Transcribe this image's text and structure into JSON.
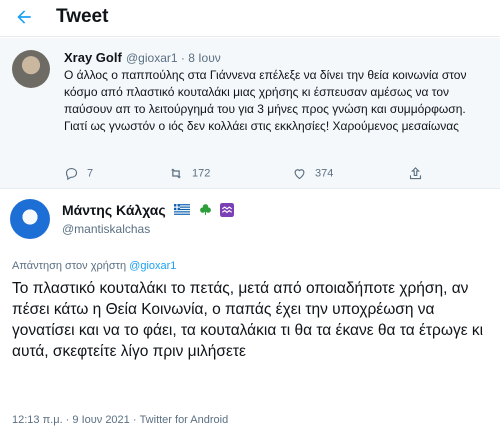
{
  "header": {
    "title": "Tweet",
    "back_icon": "back-arrow-icon",
    "accent": "#1da1f2"
  },
  "parent_tweet": {
    "display_name": "Xray Golf",
    "handle": "@gioxar1",
    "separator": " · ",
    "date": "8 Ιουν",
    "text": "Ο άλλος ο παππούλης στα Γιάννενα επέλεξε να δίνει την θεία κοινωνία στον κόσμο από πλαστικό κουταλάκι μιας χρήσης κι έσπευσαν αμέσως να τον παύσουν απ το λειτούργημά του για 3 μήνες προς γνώση και συμμόρφωση. Γιατί ως γνωστόν ο ιός δεν κολλάει στις εκκλησίες! Χαρούμενος μεσαίωνας",
    "actions": {
      "replies": "7",
      "retweets": "172",
      "likes": "374"
    }
  },
  "main_tweet": {
    "display_name": "Μάντης Κάλχας",
    "handle": "@mantiskalchas",
    "badges": [
      "greek-flag-icon",
      "shamrock-icon",
      "aquarius-sign-icon"
    ],
    "reply_prefix": "Απάντηση στον χρήστη ",
    "reply_to": "@gioxar1",
    "text": "Το πλαστικό κουταλάκι το πετάς, μετά από οποιαδήποτε χρήση, αν πέσει κάτω η Θεία Κοινωνία, ο παπάς έχει την υποχρέωση να γονατίσει και να το φάει, τα κουταλάκια τι θα τα έκανε θα τα έτρωγε κι αυτά, σκεφτείτε λίγο πριν μιλήσετε",
    "timestamp": "12:13 π.μ. · 9 Ιουν 2021 · Twitter for Android"
  }
}
